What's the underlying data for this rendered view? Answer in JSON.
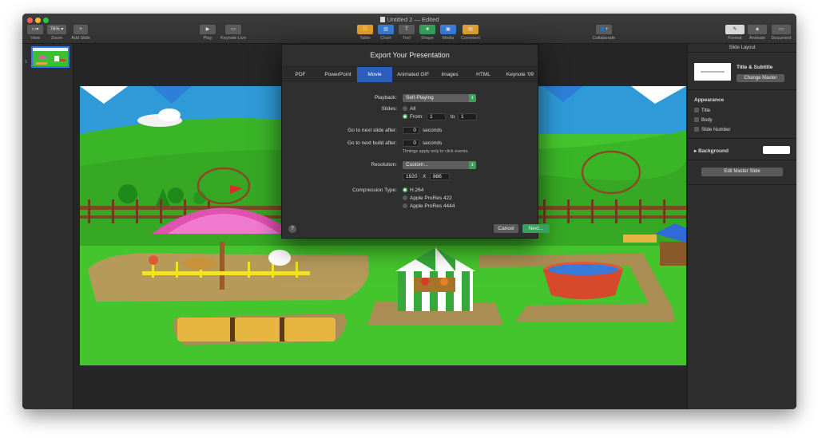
{
  "window": {
    "title": "Untitled 2 — Edited"
  },
  "toolbar": {
    "left": [
      {
        "name": "view",
        "label": "View",
        "glyph": "▭▾"
      },
      {
        "name": "zoom",
        "label": "Zoom",
        "glyph": "76% ▾"
      },
      {
        "name": "add-slide",
        "label": "Add Slide",
        "glyph": "+"
      }
    ],
    "center_left": [
      {
        "name": "play",
        "label": "Play",
        "glyph": "▶"
      },
      {
        "name": "keynote-live",
        "label": "Keynote Live",
        "glyph": "▭"
      }
    ],
    "insert": [
      {
        "name": "table",
        "label": "Table",
        "glyph": "☷"
      },
      {
        "name": "chart",
        "label": "Chart",
        "glyph": "▥"
      },
      {
        "name": "text",
        "label": "Text",
        "glyph": "T"
      },
      {
        "name": "shape",
        "label": "Shape",
        "glyph": "■"
      },
      {
        "name": "media",
        "label": "Media",
        "glyph": "▣"
      },
      {
        "name": "comment",
        "label": "Comment",
        "glyph": "▤"
      }
    ],
    "collaborate": {
      "label": "Collaborate",
      "glyph": "👤+"
    },
    "right": [
      {
        "name": "format",
        "label": "Format",
        "glyph": "✎"
      },
      {
        "name": "animate",
        "label": "Animate",
        "glyph": "◈"
      },
      {
        "name": "document",
        "label": "Document",
        "glyph": "▭"
      }
    ]
  },
  "navigator": {
    "slide_number": "1"
  },
  "inspector": {
    "header": "Slide Layout",
    "master_title": "Title & Subtitle",
    "change_master": "Change Master",
    "appearance": "Appearance",
    "checkboxes": [
      "Title",
      "Body",
      "Slide Number"
    ],
    "background": "Background",
    "edit_master": "Edit Master Slide"
  },
  "dialog": {
    "title": "Export Your Presentation",
    "tabs": [
      "PDF",
      "PowerPoint",
      "Movie",
      "Animated GIF",
      "Images",
      "HTML",
      "Keynote '09"
    ],
    "active_tab": "Movie",
    "playback_label": "Playback:",
    "playback_value": "Self-Playing",
    "slides_label": "Slides:",
    "slides_all": "All",
    "slides_from": "From:",
    "from_value": "1",
    "to_label": "to",
    "to_value": "1",
    "next_slide_label": "Go to next slide after:",
    "next_slide_value": "0",
    "next_build_label": "Go to next build after:",
    "next_build_value": "0",
    "seconds": "seconds",
    "timing_note": "Timings apply only to click events.",
    "resolution_label": "Resolution:",
    "resolution_value": "Custom...",
    "width_value": "1920",
    "times": "X",
    "height_value": "886",
    "compression_label": "Compression Type:",
    "compression_options": [
      "H.264",
      "Apple ProRes 422",
      "Apple ProRes 4444"
    ],
    "help": "?",
    "cancel": "Cancel",
    "next": "Next..."
  },
  "colors": {
    "accent": "#2c5fbd",
    "confirm": "#37a05a",
    "slide_grass": "#45c52d"
  }
}
